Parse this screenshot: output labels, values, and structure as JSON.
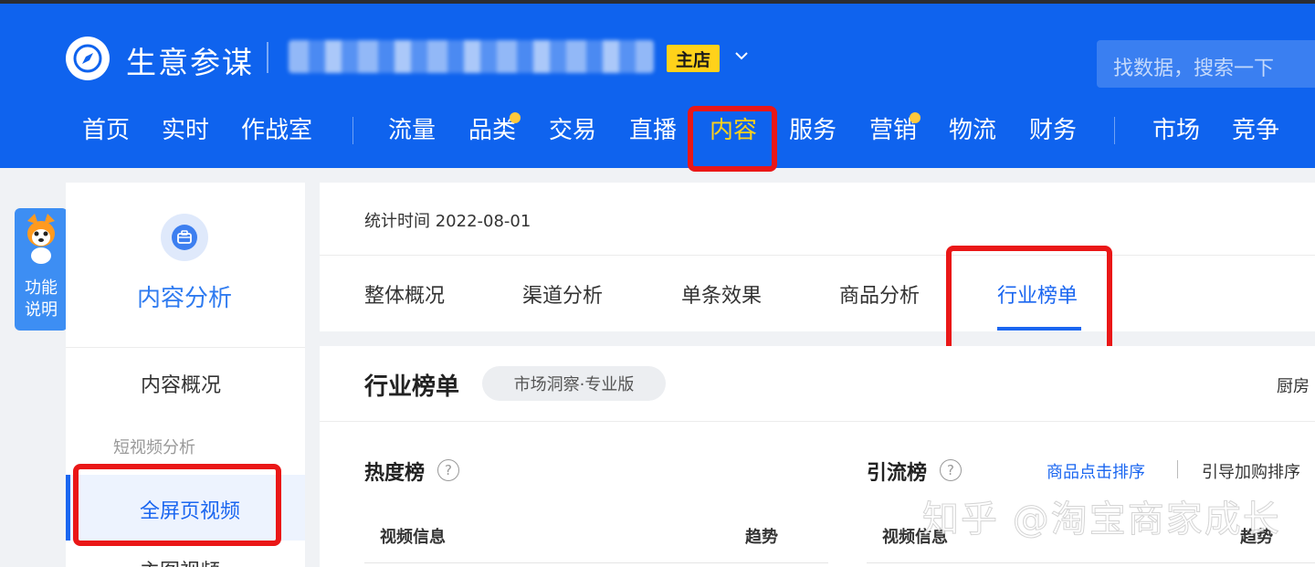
{
  "header": {
    "app_name": "生意参谋",
    "shop_badge": "主店",
    "search_placeholder": "找数据，搜索一下"
  },
  "nav": {
    "items": [
      {
        "label": "首页"
      },
      {
        "label": "实时"
      },
      {
        "label": "作战室"
      },
      {
        "label": "流量"
      },
      {
        "label": "品类",
        "has_dot": true
      },
      {
        "label": "交易"
      },
      {
        "label": "直播"
      },
      {
        "label": "内容",
        "highlighted": true
      },
      {
        "label": "服务"
      },
      {
        "label": "营销",
        "has_dot": true
      },
      {
        "label": "物流"
      },
      {
        "label": "财务"
      },
      {
        "label": "市场"
      },
      {
        "label": "竞争"
      }
    ],
    "dot_color": "#ffc93c"
  },
  "helper": {
    "label": "功能说明"
  },
  "sidebar": {
    "title": "内容分析",
    "overview": "内容概况",
    "section_label": "短视频分析",
    "active_item": "全屏页视频",
    "next_item": "主图视频"
  },
  "stats": {
    "time_label": "统计时间 2022-08-01",
    "tabs": [
      {
        "label": "整体概况"
      },
      {
        "label": "渠道分析"
      },
      {
        "label": "单条效果"
      },
      {
        "label": "商品分析"
      },
      {
        "label": "行业榜单",
        "active": true
      }
    ]
  },
  "ranking": {
    "title": "行业榜单",
    "pill": "市场洞察·专业版",
    "category_fragment": "厨房",
    "hot": {
      "title": "热度榜",
      "col_video": "视频信息",
      "col_trend": "趋势"
    },
    "traffic": {
      "title": "引流榜",
      "sort_click": "商品点击排序",
      "sort_cart": "引导加购排序",
      "col_video": "视频信息",
      "col_trend": "趋势"
    }
  },
  "watermark": "知乎 @淘宝商家成长",
  "colors": {
    "header_blue": "#0f63ee",
    "accent_blue": "#1a66f0",
    "badge_yellow": "#ffd21a",
    "annotation_red": "#ea1717"
  }
}
